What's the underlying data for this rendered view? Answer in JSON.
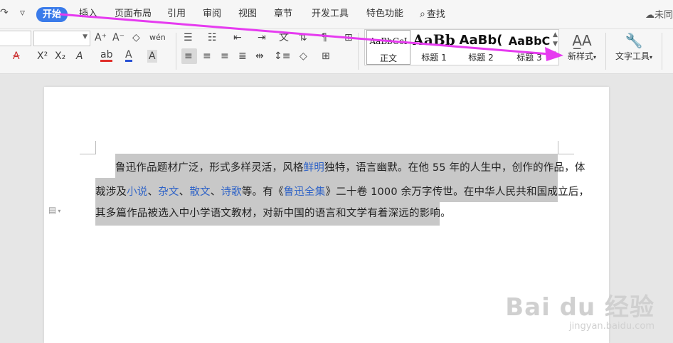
{
  "menu": {
    "undo_icon": "↷",
    "more_icon": "▿",
    "tabs": [
      {
        "label": "开始",
        "active": true
      },
      {
        "label": "插入"
      },
      {
        "label": "页面布局"
      },
      {
        "label": "引用"
      },
      {
        "label": "审阅"
      },
      {
        "label": "视图"
      },
      {
        "label": "章节"
      },
      {
        "label": "开发工具"
      },
      {
        "label": "特色功能"
      }
    ],
    "search_label": "查找",
    "sync_status": "未同"
  },
  "toolbar": {
    "font_grow": "A⁺",
    "font_shrink": "A⁻",
    "clear_format": "◇",
    "phonetic": "wén",
    "strike": "A",
    "superscript": "X²",
    "subscript": "X₂",
    "text_effect": "A",
    "highlight": "ab",
    "font_color": "A",
    "char_shading": "A",
    "new_style_label": "新样式",
    "text_tools_label": "文字工具"
  },
  "styles": {
    "items": [
      {
        "sample": "AaBbCcI",
        "label": "正文"
      },
      {
        "sample": "AaBb",
        "label": "标题 1"
      },
      {
        "sample": "AaBb(",
        "label": "标题 2"
      },
      {
        "sample": "AaBbC",
        "label": "标题 3"
      }
    ]
  },
  "document": {
    "line1": {
      "before": "鲁迅作品题材广泛，形式多样灵活，风格",
      "link": "鲜明",
      "after": "独特，语言幽默。在他 55 年的人生中，创作的作品，体"
    },
    "line2": {
      "t1": "裁涉及",
      "l1": "小说",
      "t2": "、",
      "l2": "杂文",
      "t3": "、",
      "l3": "散文",
      "t4": "、",
      "l4": "诗歌",
      "t5": "等。有《",
      "l5": "鲁迅全集",
      "t6": "》二十卷 1000 余万字传世。在中华人民共和国成立后，"
    },
    "line3": "其多篇作品被选入中小学语文教材，对新中国的语言和文学有着深远的影响。"
  },
  "watermark": {
    "brand": "Bai du 经验",
    "url": "jingyan.baidu.com"
  },
  "colors": {
    "accent": "#3a7bea",
    "annotation": "#e63bf0",
    "link": "#2f63c7"
  }
}
